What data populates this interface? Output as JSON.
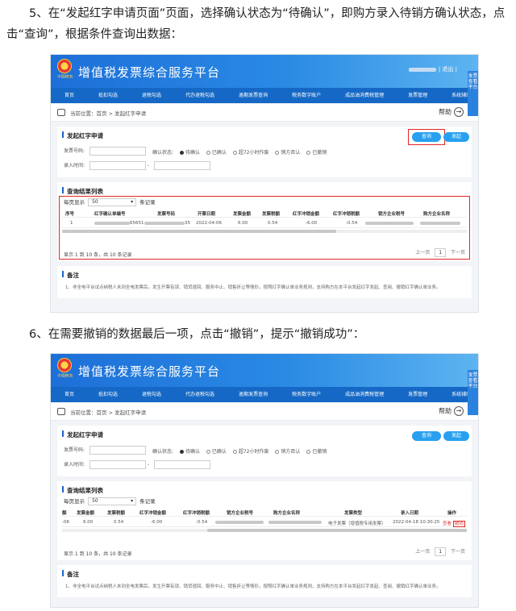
{
  "steps": {
    "step5": "5、在“发起红字申请页面”页面，选择确认状态为“待确认”，即购方录入待销方确认状态，点击“查询”，根据条件查询出数据：",
    "step6": "6、在需要撤销的数据最后一项，点击“撤销”，提示“撤销成功”："
  },
  "app": {
    "title": "增值税发票综合服务平台",
    "logo_caption": "中国税务",
    "user_suffix": "| 退出 |",
    "side_tab": "发票查看平台"
  },
  "nav": [
    "首页",
    "抵扣勾选",
    "退税勾选",
    "代办退税勾选",
    "逾期发票查询",
    "税务数字账户",
    "成品油消费税管理",
    "发票管理",
    "系统辅助功能"
  ],
  "breadcrumb": {
    "label": "当前位置：首页 > 发起红字申请",
    "help": "帮助"
  },
  "form": {
    "title": "发起红字申请",
    "invoice_no_label": "发票号码:",
    "status_label": "确认状态:",
    "status_options": [
      "待确认",
      "已确认",
      "超72小时作废",
      "销方否认",
      "已撤销"
    ],
    "selected_status": "待确认",
    "entry_time_label": "录入时间:",
    "date_sep": "-",
    "query_button": "查询",
    "new_button": "发起"
  },
  "results": {
    "title": "查询结果列表",
    "page_size_prefix": "每页显示",
    "page_size": "50",
    "page_size_suffix": "条记录",
    "columns_view1": [
      "序号",
      "红字确认单编号",
      "发票号码",
      "开票日期",
      "发票金额",
      "发票税额",
      "红字冲销金额",
      "红字冲销税额",
      "销方企业税号",
      "购方企业名称"
    ],
    "row_view1": {
      "index": "1",
      "confirm_no_tail": "65651",
      "invoice_no_tail": "35",
      "date": "2022-04-06",
      "amount": "6.00",
      "tax": "0.54",
      "red_amount": "-6.00",
      "red_tax": "-0.54"
    },
    "columns_view2": [
      "额",
      "发票金额",
      "发票税额",
      "红字冲销金额",
      "红字冲销税额",
      "销方企业税号",
      "购方企业名称",
      "发票类型",
      "录入日期",
      "操作"
    ],
    "row_view2": {
      "date_tail": "-06",
      "amount": "6.00",
      "tax": "0.54",
      "red_amount": "-6.00",
      "red_tax": "-0.54",
      "invoice_type": "电子发票（增值税专用发票）",
      "entry_date": "2022-04-18 10:30:25",
      "view": "查看",
      "revoke": "撤销"
    },
    "pager_info": "显示 1 到 10 条，共 10 条记录",
    "prev": "上一页",
    "page": "1",
    "next": "下一页"
  },
  "note": {
    "title": "备注",
    "text": "1、非全电平台试点纳税人未到全电发票后，发生开票有误、销货退回、服务中止、销售折让等情形，按照红字确认单业务规则，支持购方在本平台发起红字发起、查阅、撤销红字确认单业务。"
  }
}
